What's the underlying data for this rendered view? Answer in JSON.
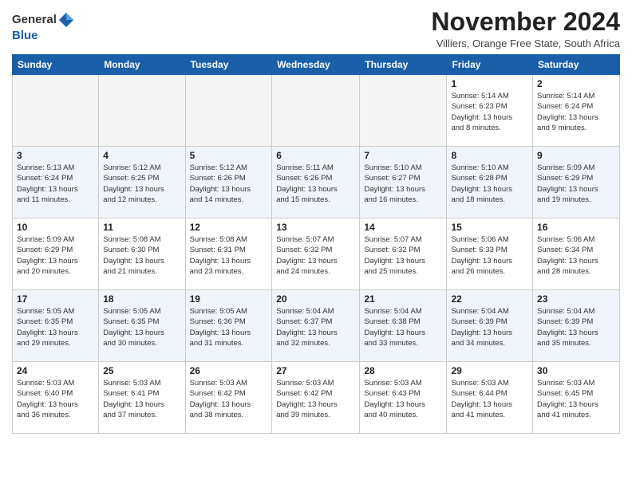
{
  "logo": {
    "general": "General",
    "blue": "Blue"
  },
  "title": "November 2024",
  "subtitle": "Villiers, Orange Free State, South Africa",
  "weekdays": [
    "Sunday",
    "Monday",
    "Tuesday",
    "Wednesday",
    "Thursday",
    "Friday",
    "Saturday"
  ],
  "weeks": [
    [
      {
        "day": "",
        "info": ""
      },
      {
        "day": "",
        "info": ""
      },
      {
        "day": "",
        "info": ""
      },
      {
        "day": "",
        "info": ""
      },
      {
        "day": "",
        "info": ""
      },
      {
        "day": "1",
        "info": "Sunrise: 5:14 AM\nSunset: 6:23 PM\nDaylight: 13 hours\nand 8 minutes."
      },
      {
        "day": "2",
        "info": "Sunrise: 5:14 AM\nSunset: 6:24 PM\nDaylight: 13 hours\nand 9 minutes."
      }
    ],
    [
      {
        "day": "3",
        "info": "Sunrise: 5:13 AM\nSunset: 6:24 PM\nDaylight: 13 hours\nand 11 minutes."
      },
      {
        "day": "4",
        "info": "Sunrise: 5:12 AM\nSunset: 6:25 PM\nDaylight: 13 hours\nand 12 minutes."
      },
      {
        "day": "5",
        "info": "Sunrise: 5:12 AM\nSunset: 6:26 PM\nDaylight: 13 hours\nand 14 minutes."
      },
      {
        "day": "6",
        "info": "Sunrise: 5:11 AM\nSunset: 6:26 PM\nDaylight: 13 hours\nand 15 minutes."
      },
      {
        "day": "7",
        "info": "Sunrise: 5:10 AM\nSunset: 6:27 PM\nDaylight: 13 hours\nand 16 minutes."
      },
      {
        "day": "8",
        "info": "Sunrise: 5:10 AM\nSunset: 6:28 PM\nDaylight: 13 hours\nand 18 minutes."
      },
      {
        "day": "9",
        "info": "Sunrise: 5:09 AM\nSunset: 6:29 PM\nDaylight: 13 hours\nand 19 minutes."
      }
    ],
    [
      {
        "day": "10",
        "info": "Sunrise: 5:09 AM\nSunset: 6:29 PM\nDaylight: 13 hours\nand 20 minutes."
      },
      {
        "day": "11",
        "info": "Sunrise: 5:08 AM\nSunset: 6:30 PM\nDaylight: 13 hours\nand 21 minutes."
      },
      {
        "day": "12",
        "info": "Sunrise: 5:08 AM\nSunset: 6:31 PM\nDaylight: 13 hours\nand 23 minutes."
      },
      {
        "day": "13",
        "info": "Sunrise: 5:07 AM\nSunset: 6:32 PM\nDaylight: 13 hours\nand 24 minutes."
      },
      {
        "day": "14",
        "info": "Sunrise: 5:07 AM\nSunset: 6:32 PM\nDaylight: 13 hours\nand 25 minutes."
      },
      {
        "day": "15",
        "info": "Sunrise: 5:06 AM\nSunset: 6:33 PM\nDaylight: 13 hours\nand 26 minutes."
      },
      {
        "day": "16",
        "info": "Sunrise: 5:06 AM\nSunset: 6:34 PM\nDaylight: 13 hours\nand 28 minutes."
      }
    ],
    [
      {
        "day": "17",
        "info": "Sunrise: 5:05 AM\nSunset: 6:35 PM\nDaylight: 13 hours\nand 29 minutes."
      },
      {
        "day": "18",
        "info": "Sunrise: 5:05 AM\nSunset: 6:35 PM\nDaylight: 13 hours\nand 30 minutes."
      },
      {
        "day": "19",
        "info": "Sunrise: 5:05 AM\nSunset: 6:36 PM\nDaylight: 13 hours\nand 31 minutes."
      },
      {
        "day": "20",
        "info": "Sunrise: 5:04 AM\nSunset: 6:37 PM\nDaylight: 13 hours\nand 32 minutes."
      },
      {
        "day": "21",
        "info": "Sunrise: 5:04 AM\nSunset: 6:38 PM\nDaylight: 13 hours\nand 33 minutes."
      },
      {
        "day": "22",
        "info": "Sunrise: 5:04 AM\nSunset: 6:39 PM\nDaylight: 13 hours\nand 34 minutes."
      },
      {
        "day": "23",
        "info": "Sunrise: 5:04 AM\nSunset: 6:39 PM\nDaylight: 13 hours\nand 35 minutes."
      }
    ],
    [
      {
        "day": "24",
        "info": "Sunrise: 5:03 AM\nSunset: 6:40 PM\nDaylight: 13 hours\nand 36 minutes."
      },
      {
        "day": "25",
        "info": "Sunrise: 5:03 AM\nSunset: 6:41 PM\nDaylight: 13 hours\nand 37 minutes."
      },
      {
        "day": "26",
        "info": "Sunrise: 5:03 AM\nSunset: 6:42 PM\nDaylight: 13 hours\nand 38 minutes."
      },
      {
        "day": "27",
        "info": "Sunrise: 5:03 AM\nSunset: 6:42 PM\nDaylight: 13 hours\nand 39 minutes."
      },
      {
        "day": "28",
        "info": "Sunrise: 5:03 AM\nSunset: 6:43 PM\nDaylight: 13 hours\nand 40 minutes."
      },
      {
        "day": "29",
        "info": "Sunrise: 5:03 AM\nSunset: 6:44 PM\nDaylight: 13 hours\nand 41 minutes."
      },
      {
        "day": "30",
        "info": "Sunrise: 5:03 AM\nSunset: 6:45 PM\nDaylight: 13 hours\nand 41 minutes."
      }
    ]
  ]
}
